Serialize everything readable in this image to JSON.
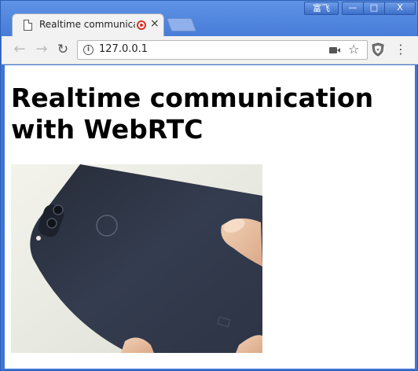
{
  "window": {
    "user_label": "富飞",
    "min_glyph": "—",
    "max_glyph": "□",
    "close_glyph": "X"
  },
  "tab": {
    "title": "Realtime communicati",
    "close_glyph": "×"
  },
  "toolbar": {
    "back_glyph": "←",
    "forward_glyph": "→",
    "reload_glyph": "↻",
    "url": "127.0.0.1",
    "info_glyph": "i",
    "star_glyph": "☆",
    "menu_glyph": "⋮"
  },
  "page": {
    "heading": "Realtime communication with WebRTC"
  },
  "colors": {
    "frame": "#4a7fd9",
    "recording": "#d93025",
    "phone_body": "#2b3242"
  },
  "icons": [
    "doc-icon",
    "recording-icon",
    "tab-close-icon",
    "back-icon",
    "forward-icon",
    "reload-icon",
    "info-icon",
    "camera-icon",
    "star-icon",
    "extension-shield-icon",
    "menu-icon"
  ]
}
